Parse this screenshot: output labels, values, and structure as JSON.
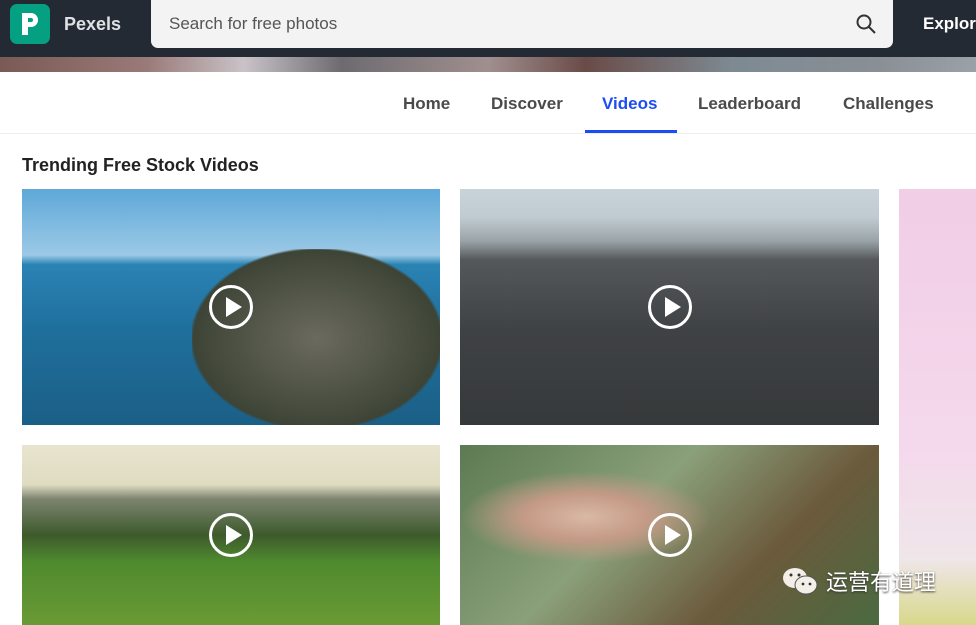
{
  "header": {
    "brand": "Pexels",
    "search_placeholder": "Search for free photos",
    "explore": "Explore"
  },
  "nav": {
    "tabs": [
      {
        "label": "Home"
      },
      {
        "label": "Discover"
      },
      {
        "label": "Videos",
        "active": true
      },
      {
        "label": "Leaderboard"
      },
      {
        "label": "Challenges"
      }
    ]
  },
  "section_title": "Trending Free Stock Videos",
  "videos": [
    {
      "subject": "coast"
    },
    {
      "subject": "rooftop"
    },
    {
      "subject": "countryside"
    },
    {
      "subject": "hand-flowers"
    },
    {
      "subject": "pink"
    }
  ],
  "watermark": "运营有道理",
  "colors": {
    "accent": "#1c4cf5",
    "brand": "#05a081",
    "topbar": "#232a34"
  }
}
